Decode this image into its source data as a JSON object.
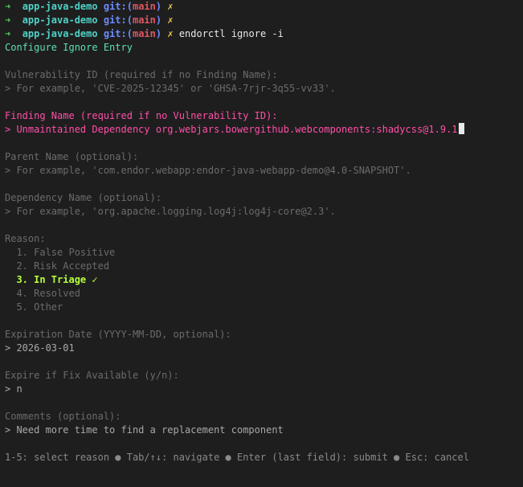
{
  "prompt": {
    "arrow": "➜",
    "directory": "app-java-demo",
    "git_label": "git:(",
    "branch": "main",
    "git_close": ")",
    "dirty_mark": "✗"
  },
  "command": "endorctl ignore -i",
  "form_title": "Configure Ignore Entry",
  "fields": {
    "vuln_id": {
      "label": "Vulnerability ID (required if no Finding Name):",
      "placeholder": "> For example, 'CVE-2025-12345' or 'GHSA-7rjr-3q55-vv33'."
    },
    "finding_name": {
      "label": "Finding Name (required if no Vulnerability ID):",
      "value": "> Unmaintained Dependency org.webjars.bowergithub.webcomponents:shadycss@1.9.1"
    },
    "parent_name": {
      "label": "Parent Name (optional):",
      "placeholder": "> For example, 'com.endor.webapp:endor-java-webapp-demo@4.0-SNAPSHOT'."
    },
    "dependency_name": {
      "label": "Dependency Name (optional):",
      "placeholder": "> For example, 'org.apache.logging.log4j:log4j-core@2.3'."
    },
    "reason": {
      "label": "Reason:",
      "options": [
        "  1. False Positive",
        "  2. Risk Accepted",
        "  3. In Triage ✓",
        "  4. Resolved",
        "  5. Other"
      ],
      "selected_index": 2
    },
    "expiration": {
      "label": "Expiration Date (YYYY-MM-DD, optional):",
      "value": "> 2026-03-01"
    },
    "expire_if_fix": {
      "label": "Expire if Fix Available (y/n):",
      "value": "> n"
    },
    "comments": {
      "label": "Comments (optional):",
      "value": "> Need more time to find a replacement component"
    }
  },
  "help_bar": "1-5: select reason ● Tab/↑↓: navigate ● Enter (last field): submit ● Esc: cancel"
}
